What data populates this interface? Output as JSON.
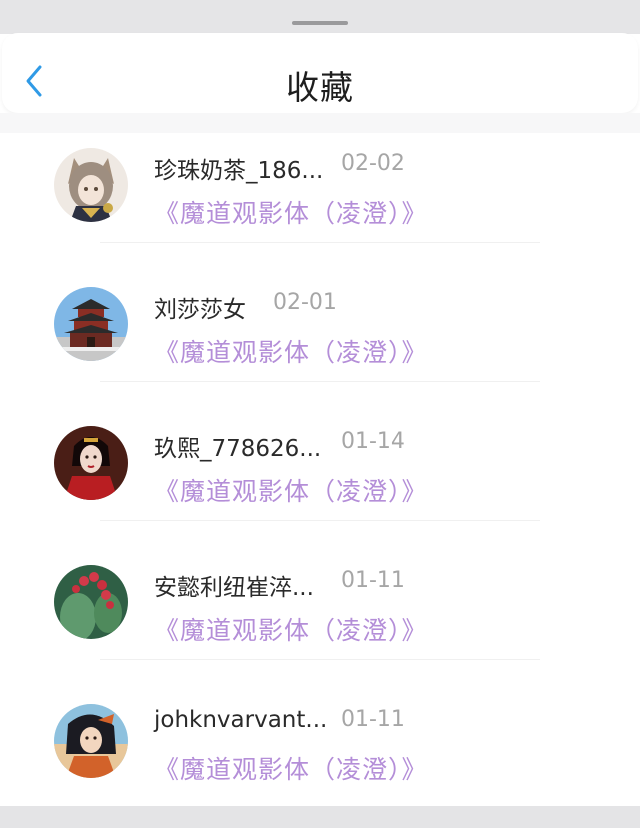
{
  "header": {
    "title": "收藏",
    "back_icon": "chevron-left-icon",
    "back_color": "#2f9ae6"
  },
  "favorites": [
    {
      "name": "珍珠奶茶_186...",
      "date": "02-02",
      "work": "《魔道观影体（凌澄）》",
      "avatar": "anime-catgirl-avatar"
    },
    {
      "name": "刘莎莎女",
      "date": "02-01",
      "work": "《魔道观影体（凌澄）》",
      "avatar": "pagoda-avatar"
    },
    {
      "name": "玖熙_778626...",
      "date": "01-14",
      "work": "《魔道观影体（凌澄）》",
      "avatar": "red-dress-woman-avatar"
    },
    {
      "name": "安懿利纽崔淬...",
      "date": "01-11",
      "work": "《魔道观影体（凌澄）》",
      "avatar": "cactus-fruit-avatar"
    },
    {
      "name": "johknvarvant...",
      "date": "01-11",
      "work": "《魔道观影体（凌澄）》",
      "avatar": "illustrated-girl-avatar"
    }
  ],
  "colors": {
    "work_title": "#b48ed8",
    "date": "#a6a6a6",
    "name": "#2a2a2a"
  }
}
